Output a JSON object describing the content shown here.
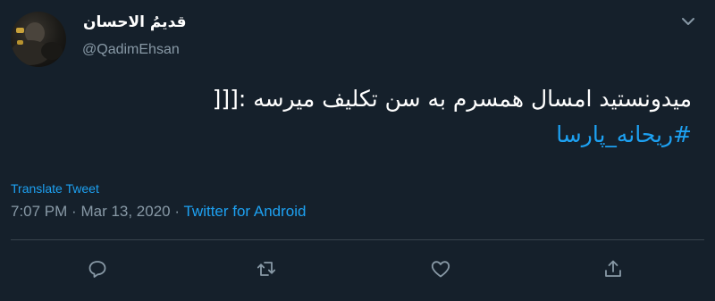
{
  "user": {
    "display_name": "قدیمُ الاحسان",
    "handle": "@QadimEhsan"
  },
  "tweet": {
    "text_line1": "میدونستید امسال همسرم به سن تکلیف میرسه :[[[",
    "hashtag": "#ریحانه_پارسا"
  },
  "translate_label": "Translate Tweet",
  "meta": {
    "time": "7:07 PM",
    "date": "Mar 13, 2020",
    "separator": "·",
    "source": "Twitter for Android"
  },
  "icons": {
    "menu": "chevron-down-icon",
    "reply": "reply-icon",
    "retweet": "retweet-icon",
    "like": "heart-icon",
    "share": "share-icon"
  },
  "colors": {
    "background": "#15202b",
    "accent": "#1da1f2",
    "secondary_text": "#8899a6",
    "divider": "#38444d"
  }
}
